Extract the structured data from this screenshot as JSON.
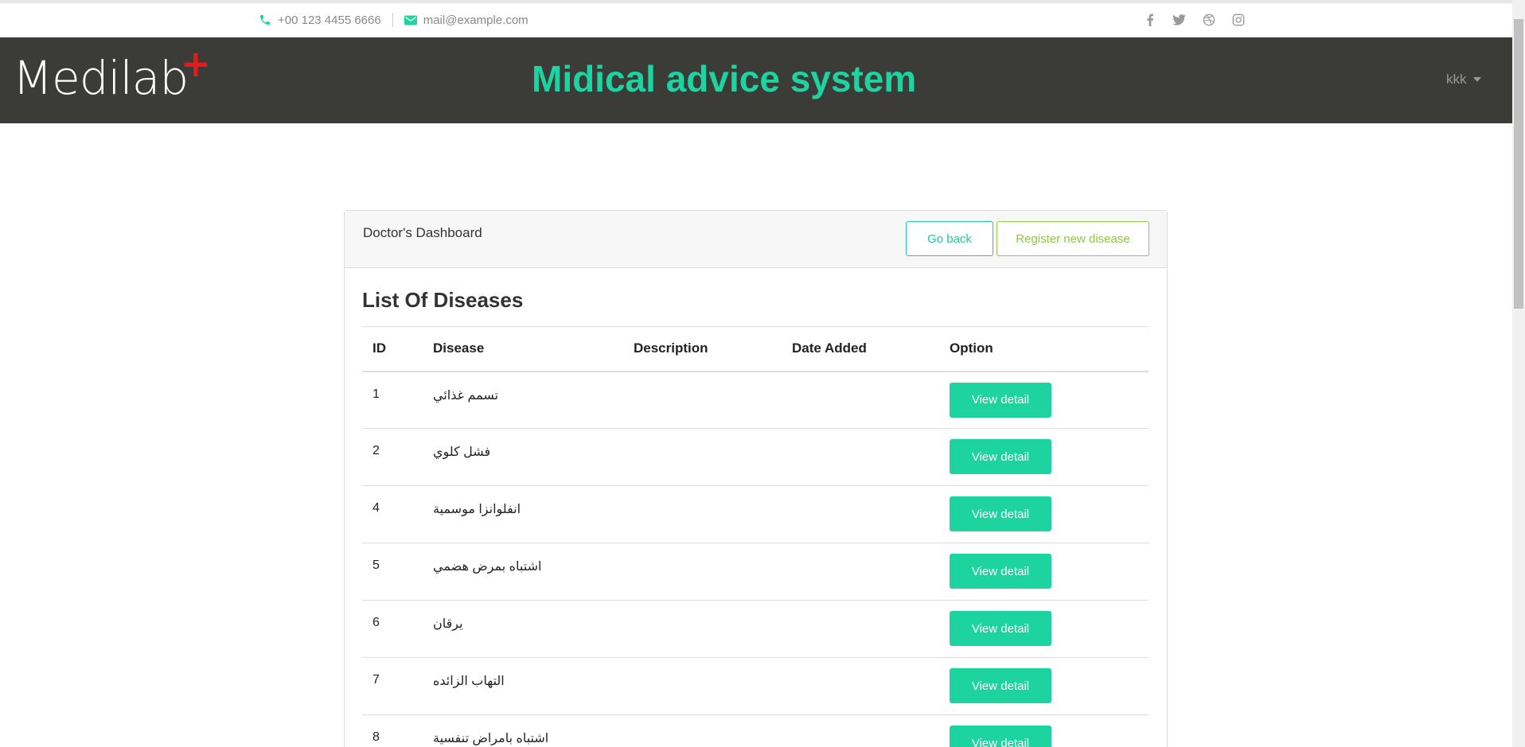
{
  "topbar": {
    "phone": "+00 123 4455 6666",
    "email": "mail@example.com",
    "social_icons": [
      "facebook-icon",
      "twitter-icon",
      "dribbble-icon",
      "instagram-icon"
    ],
    "accent": "#1dd3a0"
  },
  "header": {
    "logo_text": "Medilab",
    "logo_plus": "+",
    "title": "Midical advice system",
    "user": "kkk",
    "bg_color": "#3b3b37",
    "title_color": "#1dd3a0"
  },
  "dashboard": {
    "title": "Doctor's Dashboard",
    "back_label": "Go back",
    "register_label": "Register new disease",
    "list_title": "List Of Diseases",
    "columns": [
      "ID",
      "Disease",
      "Description",
      "Date Added",
      "Option"
    ],
    "rows": [
      {
        "id": "1",
        "disease": "تسمم غذائي",
        "description": "",
        "date": "",
        "option": "View detail"
      },
      {
        "id": "2",
        "disease": "فشل كلوي",
        "description": "",
        "date": "",
        "option": "View detail"
      },
      {
        "id": "4",
        "disease": "انفلوانزا موسمية",
        "description": "",
        "date": "",
        "option": "View detail"
      },
      {
        "id": "5",
        "disease": "اشتباه بمرض هضمي",
        "description": "",
        "date": "",
        "option": "View detail"
      },
      {
        "id": "6",
        "disease": "يرقان",
        "description": "",
        "date": "",
        "option": "View detail"
      },
      {
        "id": "7",
        "disease": "التهاب الزائده",
        "description": "",
        "date": "",
        "option": "View detail"
      },
      {
        "id": "8",
        "disease": "اشتباه بامراض تنفسية",
        "description": "",
        "date": "",
        "option": "View detail"
      }
    ]
  }
}
